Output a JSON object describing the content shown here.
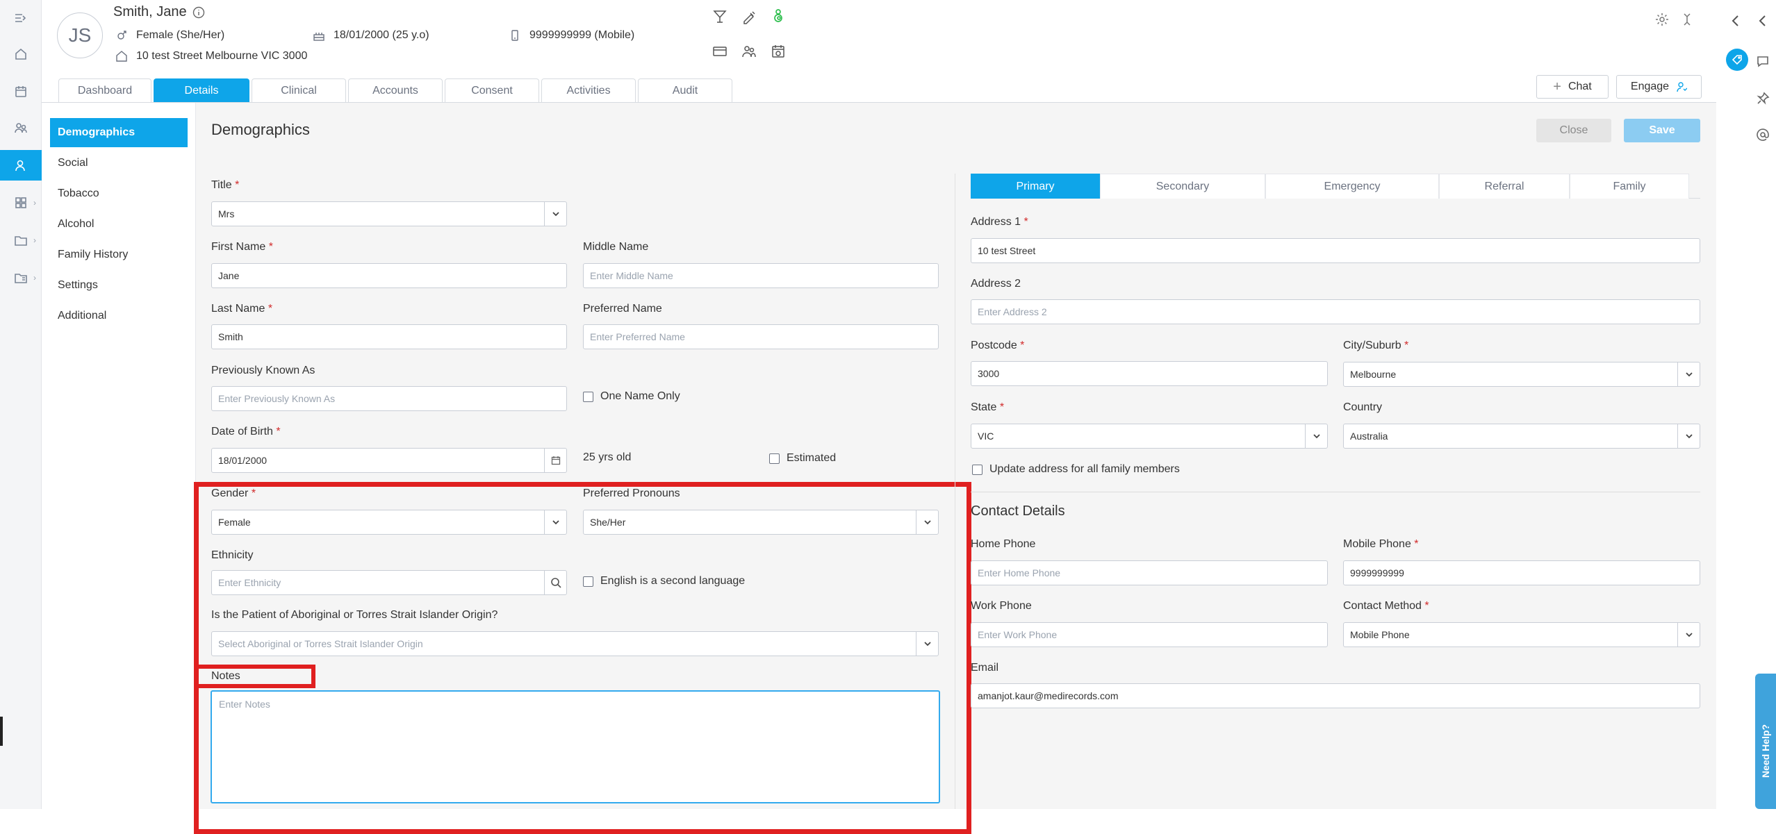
{
  "patient": {
    "initials": "JS",
    "name": "Smith, Jane",
    "gender": "Female (She/Her)",
    "dob": "18/01/2000 (25 y.o)",
    "phone": "9999999999 (Mobile)",
    "address": "10 test Street Melbourne VIC 3000"
  },
  "tabs": [
    "Dashboard",
    "Details",
    "Clinical",
    "Accounts",
    "Consent",
    "Activities",
    "Audit"
  ],
  "header_buttons": {
    "chat": "Chat",
    "engage": "Engage"
  },
  "sidenav": [
    "Demographics",
    "Social",
    "Tobacco",
    "Alcohol",
    "Family History",
    "Settings",
    "Additional"
  ],
  "section": {
    "title": "Demographics",
    "close": "Close",
    "save": "Save"
  },
  "form": {
    "title_label": "Title",
    "title_value": "Mrs",
    "first_name_label": "First Name",
    "first_name_value": "Jane",
    "middle_name_label": "Middle Name",
    "middle_name_placeholder": "Enter Middle Name",
    "last_name_label": "Last Name",
    "last_name_value": "Smith",
    "preferred_name_label": "Preferred Name",
    "preferred_name_placeholder": "Enter Preferred Name",
    "prev_known_label": "Previously Known As",
    "prev_known_placeholder": "Enter Previously Known As",
    "one_name_only": "One Name Only",
    "dob_label": "Date of Birth",
    "dob_value": "18/01/2000",
    "age_text": "25 yrs old",
    "estimated": "Estimated",
    "gender_label": "Gender",
    "gender_value": "Female",
    "pronouns_label": "Preferred Pronouns",
    "pronouns_value": "She/Her",
    "ethnicity_label": "Ethnicity",
    "ethnicity_placeholder": "Enter Ethnicity",
    "esl": "English is a second language",
    "aboriginal_label": "Is the Patient of Aboriginal or Torres Strait Islander Origin?",
    "aboriginal_placeholder": "Select Aboriginal or Torres Strait Islander Origin",
    "notes_label": "Notes",
    "notes_placeholder": "Enter Notes"
  },
  "address_tabs": [
    "Primary",
    "Secondary",
    "Emergency",
    "Referral",
    "Family"
  ],
  "address": {
    "addr1_label": "Address 1",
    "addr1_value": "10 test Street",
    "addr2_label": "Address 2",
    "addr2_placeholder": "Enter Address 2",
    "postcode_label": "Postcode",
    "postcode_value": "3000",
    "city_label": "City/Suburb",
    "city_value": "Melbourne",
    "state_label": "State",
    "state_value": "VIC",
    "country_label": "Country",
    "country_value": "Australia",
    "update_family": "Update address for all family members"
  },
  "contact": {
    "title": "Contact Details",
    "home_label": "Home Phone",
    "home_placeholder": "Enter Home Phone",
    "mobile_label": "Mobile Phone",
    "mobile_value": "9999999999",
    "work_label": "Work Phone",
    "work_placeholder": "Enter Work Phone",
    "method_label": "Contact Method",
    "method_value": "Mobile Phone",
    "email_label": "Email",
    "email_value": "amanjot.kaur@medirecords.com"
  },
  "help": "Need Help?",
  "colors": {
    "accent": "#0ea5e9",
    "highlight": "#e02020",
    "required": "#d12b2b"
  }
}
